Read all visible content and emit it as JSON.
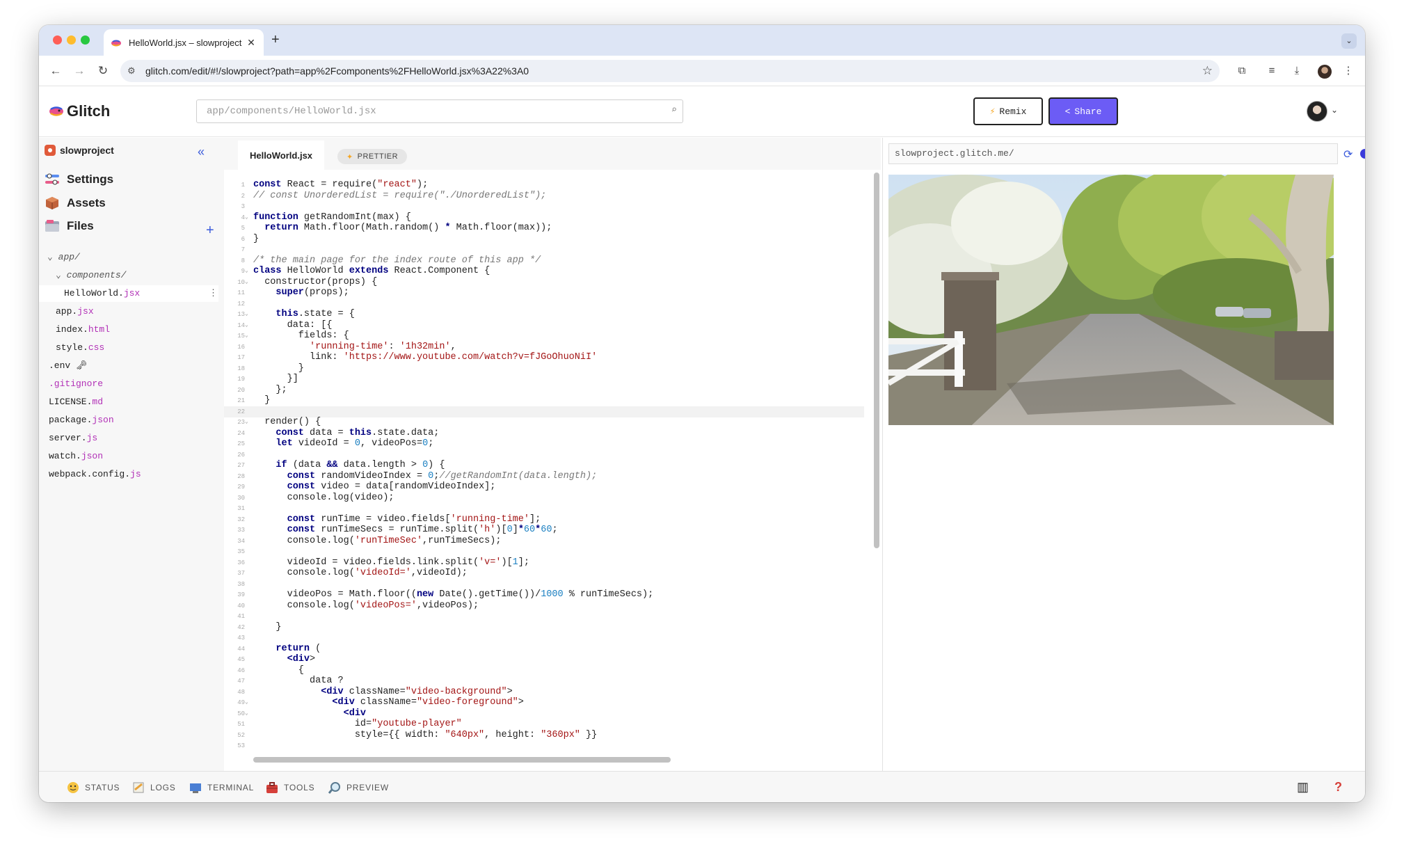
{
  "browser": {
    "tab_title": "HelloWorld.jsx – slowproject",
    "url": "glitch.com/edit/#!/slowproject?path=app%2Fcomponents%2FHelloWorld.jsx%3A22%3A0"
  },
  "header": {
    "logo_text": "Glitch",
    "search_placeholder": "app/components/HelloWorld.jsx",
    "remix_label": "Remix",
    "share_label": "Share"
  },
  "sidebar": {
    "project_name": "slowproject",
    "nav": [
      {
        "label": "Settings",
        "icon": "settings-icon"
      },
      {
        "label": "Assets",
        "icon": "assets-icon"
      },
      {
        "label": "Files",
        "icon": "files-icon"
      }
    ],
    "tree": [
      {
        "name": "app/",
        "ext": "",
        "indent": 1,
        "folder": true
      },
      {
        "name": "components/",
        "ext": "",
        "indent": 2,
        "folder": true
      },
      {
        "name": "HelloWorld.",
        "ext": "jsx",
        "indent": 3,
        "selected": true
      },
      {
        "name": "app.",
        "ext": "jsx",
        "indent": 2
      },
      {
        "name": "index.",
        "ext": "html",
        "indent": 2
      },
      {
        "name": "style.",
        "ext": "css",
        "indent": 2
      },
      {
        "name": ".env 🗝",
        "ext": "",
        "indent": 0
      },
      {
        "name": ".gitignore",
        "ext": "",
        "indent": 0,
        "allext": true
      },
      {
        "name": "LICENSE.",
        "ext": "md",
        "indent": 0
      },
      {
        "name": "package.",
        "ext": "json",
        "indent": 0
      },
      {
        "name": "server.",
        "ext": "js",
        "indent": 0
      },
      {
        "name": "watch.",
        "ext": "json",
        "indent": 0
      },
      {
        "name": "webpack.config.",
        "ext": "js",
        "indent": 0
      }
    ]
  },
  "editor": {
    "active_tab": "HelloWorld.jsx",
    "prettier_label": "PRETTIER",
    "highlighted_line": 22,
    "lines": [
      "const React = require(\"react\");",
      "// const UnorderedList = require(\"./UnorderedList\");",
      "",
      "function getRandomInt(max) {",
      "  return Math.floor(Math.random() * Math.floor(max));",
      "}",
      "",
      "/* the main page for the index route of this app */",
      "class HelloWorld extends React.Component {",
      "  constructor(props) {",
      "    super(props);",
      "",
      "    this.state = {",
      "      data: [{",
      "        fields: {",
      "          'running-time': '1h32min',",
      "          link: 'https://www.youtube.com/watch?v=fJGoOhuoNiI'",
      "        }",
      "      }]",
      "    };",
      "  }",
      "",
      "  render() {",
      "    const data = this.state.data;",
      "    let videoId = 0, videoPos=0;",
      "",
      "    if (data && data.length > 0) {",
      "      const randomVideoIndex = 0;//getRandomInt(data.length);",
      "      const video = data[randomVideoIndex];",
      "      console.log(video);",
      "",
      "      const runTime = video.fields['running-time'];",
      "      const runTimeSecs = runTime.split('h')[0]*60*60;",
      "      console.log('runTimeSec',runTimeSecs);",
      "",
      "      videoId = video.fields.link.split('v=')[1];",
      "      console.log('videoId=',videoId);",
      "",
      "      videoPos = Math.floor((new Date().getTime())/1000 % runTimeSecs);",
      "      console.log('videoPos=',videoPos);",
      "",
      "    }",
      "",
      "    return (",
      "      <div>",
      "        {",
      "          data ?",
      "            <div className=\"video-background\">",
      "              <div className=\"video-foreground\">",
      "                <div",
      "                  id=\"youtube-player\"",
      "                  style={{ width: \"640px\", height: \"360px\" }}",
      "                  "
    ],
    "folds": [
      4,
      9,
      10,
      13,
      14,
      15,
      23,
      49,
      50
    ]
  },
  "preview": {
    "url": "slowproject.glitch.me/"
  },
  "bottombar": {
    "items": [
      {
        "label": "STATUS",
        "icon": "status-icon"
      },
      {
        "label": "LOGS",
        "icon": "logs-icon"
      },
      {
        "label": "TERMINAL",
        "icon": "terminal-icon"
      },
      {
        "label": "TOOLS",
        "icon": "tools-icon"
      },
      {
        "label": "PREVIEW",
        "icon": "preview-icon"
      }
    ]
  },
  "colors": {
    "accent": "#6c5cf5",
    "link_blue": "#3b5bdb",
    "keyword": "#000080",
    "string": "#a31515",
    "comment": "#777777",
    "number": "#1a7fc1",
    "extension": "#b12fb6"
  }
}
